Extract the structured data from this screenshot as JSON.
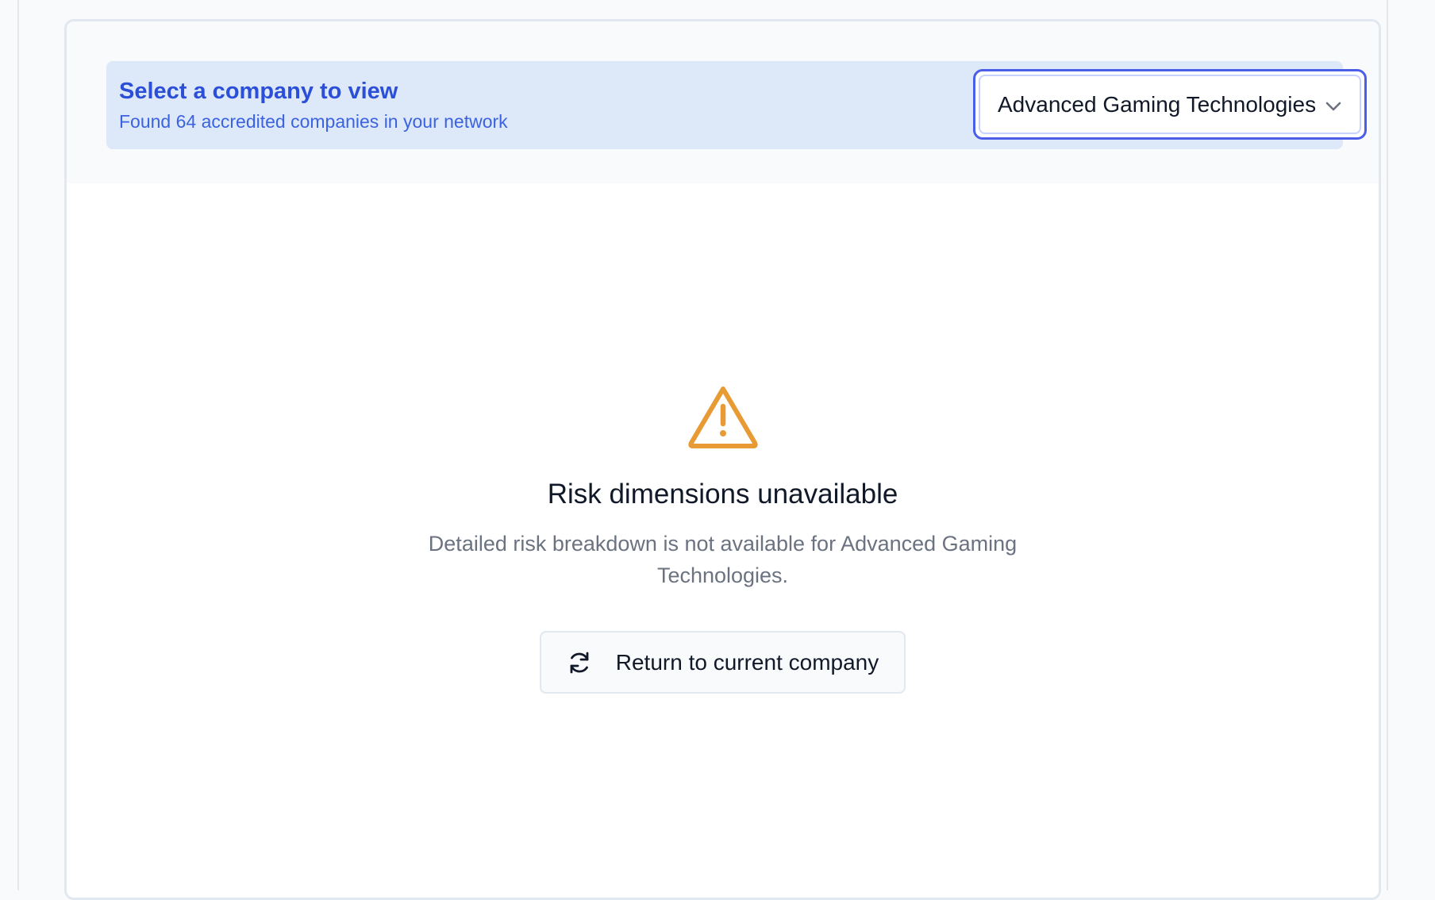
{
  "selector": {
    "title": "Select a company to view",
    "subtitle": "Found 64 accredited companies in your network",
    "selected_company": "Advanced Gaming Technologies"
  },
  "empty_state": {
    "icon": "warning-triangle-icon",
    "title": "Risk dimensions unavailable",
    "description": "Detailed risk breakdown is not available for Advanced Gaming Technologies.",
    "button_icon": "refresh-icon",
    "button_label": "Return to current company"
  },
  "colors": {
    "accent": "#2b4fd6",
    "warning": "#e89a35",
    "selector_bg": "#dde8f9",
    "focus_ring": "#4a5ee8"
  }
}
